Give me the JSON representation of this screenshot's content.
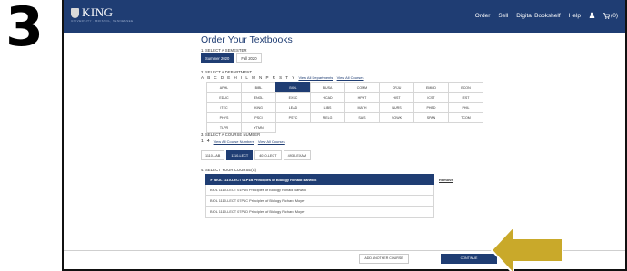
{
  "step_number": "3",
  "header": {
    "logo_text": "KING",
    "logo_subtext": "UNIVERSITY · BRISTOL, TENNESSEE",
    "nav": [
      "Order",
      "Sell",
      "Digital Bookshelf",
      "Help"
    ],
    "cart_count": "(0)"
  },
  "page": {
    "title": "Order Your Textbooks",
    "step1_label": "1. SELECT A SEMESTER",
    "semesters": [
      "Summer 2020",
      "Fall 2020"
    ],
    "step2_label": "2. SELECT A DEPARTMENT",
    "letters": [
      "A",
      "B",
      "C",
      "D",
      "E",
      "H",
      "I",
      "L",
      "M",
      "N",
      "P",
      "R",
      "S",
      "T",
      "Y"
    ],
    "view_all_departments": "View All Departments",
    "view_all_courses": "View All Courses",
    "departments": [
      "APHL",
      "BIBL",
      "BIOL",
      "BUSA",
      "COMM",
      "CRJU",
      "EMMD",
      "ECON",
      "EDUC",
      "ENGL",
      "EXSC",
      "HCAD",
      "HPHT",
      "HIST",
      "ICST",
      "IEST",
      "ITEC",
      "KING",
      "LEAD",
      "LIBS",
      "MATH",
      "NURS",
      "PHED",
      "PHIL",
      "PHYS",
      "PSCI",
      "PSYC",
      "RELG",
      "SAIS",
      "SOWK",
      "SPAN",
      "TCOM",
      "TLPR",
      "YTMN"
    ],
    "step3_label": "3. SELECT A COURSE NUMBER",
    "course_numbers_nums": [
      "1",
      "4"
    ],
    "view_all_course_numbers": "View All Course Numbers",
    "course_buttons": [
      "1110-LAB",
      "1110-LECT",
      "4010-LECT",
      "4930-EXAM"
    ],
    "step4_label": "4. SELECT YOUR COURSE(S)",
    "sections": [
      "BIOL 1110-LECT 01P1B  Principles of Biology Ronald Barwick",
      "BIOL 1110-LECT 01P1B  Principles of Biology Ronald Barwick",
      "BIOL 1110-LECT 07P1C  Principles of Biology Richard Moyer",
      "BIOL 1110-LECT 07P1D  Principles of Biology Richard Moyer"
    ],
    "selected_mark": "✔",
    "remove_label": "Remove",
    "add_button": "ADD ANOTHER COURSE",
    "continue_button": "CONTINUE"
  },
  "colors": {
    "nav_bg": "#1f3d73",
    "active_bg": "#1f3d73",
    "arrow": "#c9a92a"
  },
  "icons": [
    "user-icon",
    "cart-icon",
    "arrow-callout-icon",
    "shield-logo-icon",
    "checkmark-icon"
  ]
}
